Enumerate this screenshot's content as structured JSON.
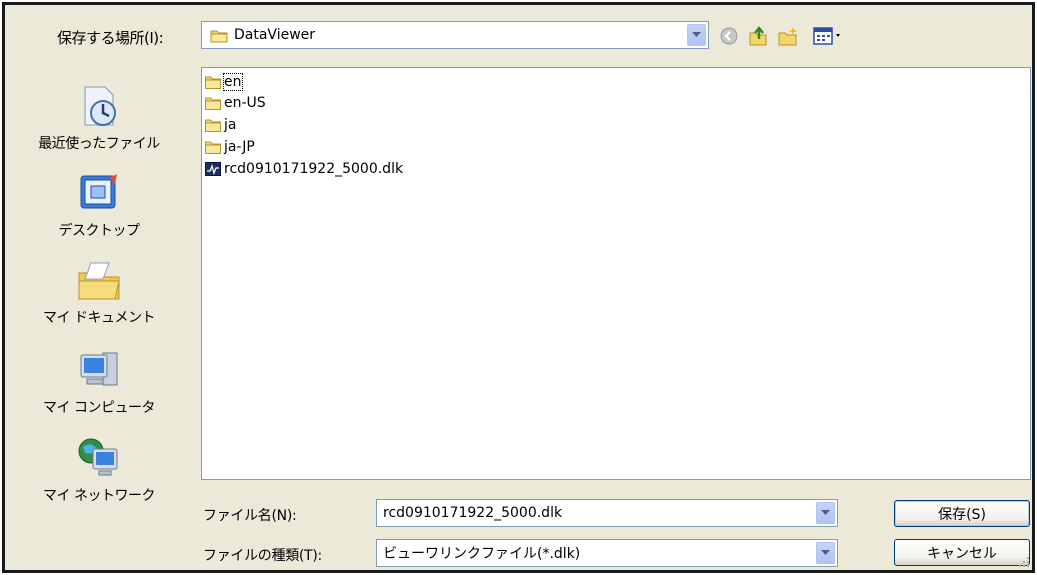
{
  "header": {
    "lookin_label": "保存する場所(I):",
    "current_folder": "DataViewer"
  },
  "places": [
    {
      "label": "最近使ったファイル",
      "icon": "recent-documents-icon"
    },
    {
      "label": "デスクトップ",
      "icon": "desktop-icon"
    },
    {
      "label": "マイ ドキュメント",
      "icon": "my-documents-icon"
    },
    {
      "label": "マイ コンピュータ",
      "icon": "my-computer-icon"
    },
    {
      "label": "マイ ネットワーク",
      "icon": "my-network-icon"
    }
  ],
  "files": [
    {
      "name": "en",
      "type": "folder"
    },
    {
      "name": "en-US",
      "type": "folder"
    },
    {
      "name": "ja",
      "type": "folder"
    },
    {
      "name": "ja-JP",
      "type": "folder"
    },
    {
      "name": "rcd0910171922_5000.dlk",
      "type": "dlk-file"
    }
  ],
  "footer": {
    "filename_label": "ファイル名(N):",
    "filename_value": "rcd0910171922_5000.dlk",
    "filetype_label": "ファイルの種類(T):",
    "filetype_value": "ビューワリンクファイル(*.dlk)",
    "save_label": "保存(S)",
    "cancel_label": "キャンセル"
  },
  "colors": {
    "dialog_bg": "#ece9d8",
    "border_blue": "#7f9db9",
    "folder_yellow": "#f5d66b"
  }
}
